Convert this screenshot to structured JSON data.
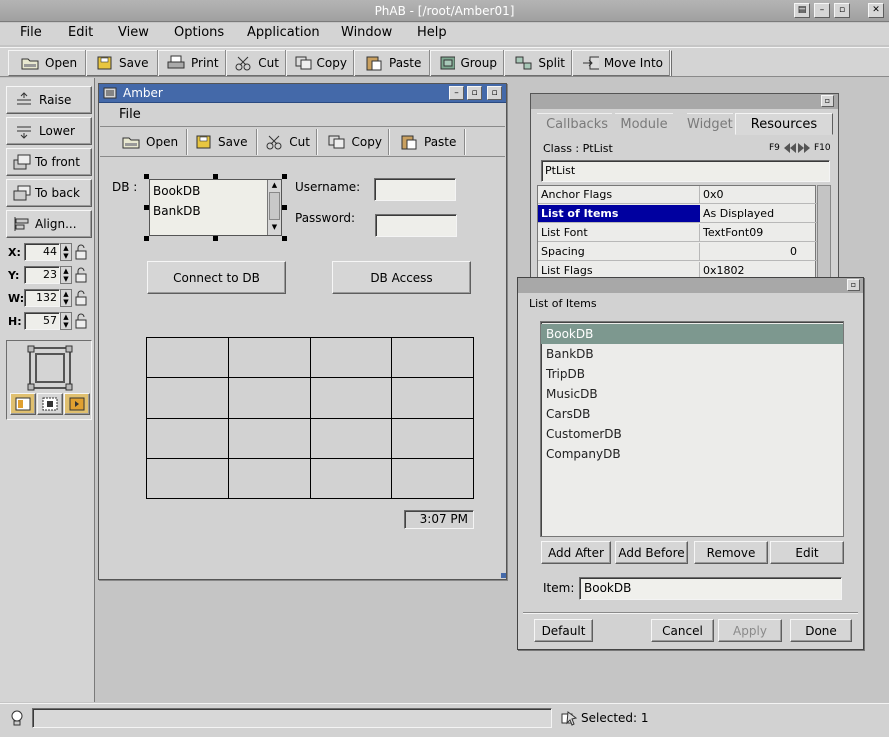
{
  "app": {
    "title": "PhAB - [/root/Amber01]",
    "menu": [
      "File",
      "Edit",
      "View",
      "Options",
      "Application",
      "Window",
      "Help"
    ],
    "toolbar": [
      {
        "label": "Open",
        "icon": "folder-open-icon"
      },
      {
        "label": "Save",
        "icon": "save-disk-icon"
      },
      {
        "label": "Print",
        "icon": "printer-icon"
      },
      {
        "label": "Cut",
        "icon": "scissors-icon"
      },
      {
        "label": "Copy",
        "icon": "copy-icon"
      },
      {
        "label": "Paste",
        "icon": "paste-clipboard-icon"
      },
      {
        "label": "Group",
        "icon": "group-icon"
      },
      {
        "label": "Split",
        "icon": "split-icon"
      },
      {
        "label": "Move Into",
        "icon": "move-into-icon"
      }
    ]
  },
  "left_panel": {
    "buttons": [
      "Raise",
      "Lower",
      "To front",
      "To back",
      "Align..."
    ],
    "coords": [
      {
        "label": "X:",
        "value": "44"
      },
      {
        "label": "Y:",
        "value": "23"
      },
      {
        "label": "W:",
        "value": "132"
      },
      {
        "label": "H:",
        "value": "57"
      }
    ]
  },
  "amber_window": {
    "title": "Amber",
    "menu_file": "File",
    "toolbar": [
      "Open",
      "Save",
      "Cut",
      "Copy",
      "Paste"
    ],
    "db_label": "DB :",
    "db_list": [
      "BookDB",
      "BankDB"
    ],
    "username_label": "Username:",
    "password_label": "Password:",
    "connect_button": "Connect to DB",
    "access_button": "DB Access",
    "clock": "3:07 PM"
  },
  "resources_window": {
    "tabs": [
      "Callbacks",
      "Module",
      "Widget",
      "Resources"
    ],
    "class_label": "Class : PtList",
    "f9": "F9",
    "f10": "F10",
    "widget_name": "PtList",
    "rows": [
      {
        "name": "Anchor Flags",
        "value": "0x0"
      },
      {
        "name": "List of Items",
        "value": "As Displayed"
      },
      {
        "name": "List Font",
        "value": "TextFont09"
      },
      {
        "name": "Spacing",
        "value": "0"
      },
      {
        "name": "List Flags",
        "value": "0x1802"
      }
    ]
  },
  "list_editor": {
    "title": "List of Items",
    "items": [
      "BookDB",
      "BankDB",
      "TripDB",
      "MusicDB",
      "CarsDB",
      "CustomerDB",
      "CompanyDB"
    ],
    "selected_index": 0,
    "buttons": [
      "Add After",
      "Add Before",
      "Remove",
      "Edit"
    ],
    "item_label": "Item:",
    "item_value": "BookDB",
    "bottom_buttons": [
      "Default",
      "Cancel",
      "Apply",
      "Done"
    ]
  },
  "status": {
    "selected": "Selected: 1"
  },
  "colors": {
    "title_active": "#4469a9",
    "title_inactive": "#a2a2a2",
    "selection": "#0000a0",
    "list_selected": "#7d988f"
  }
}
